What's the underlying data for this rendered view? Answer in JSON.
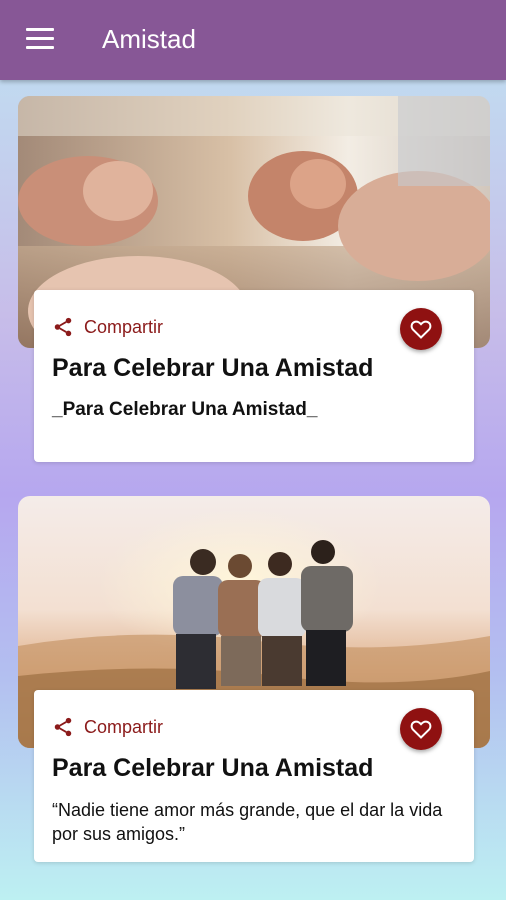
{
  "app_bar": {
    "title": "Amistad",
    "menu_icon": "menu-icon"
  },
  "colors": {
    "app_bar": "#875796",
    "accent": "#8f1111"
  },
  "cards": [
    {
      "image": "hands-praying-photo",
      "share_label": "Compartir",
      "title": "Para Celebrar Una Amistad",
      "text": "_Para Celebrar Una Amistad_"
    },
    {
      "image": "friends-hugging-sunset-photo",
      "share_label": "Compartir",
      "title": "Para Celebrar Una Amistad",
      "text": "“Nadie tiene amor más grande, que el dar la vida por sus amigos.”"
    }
  ]
}
